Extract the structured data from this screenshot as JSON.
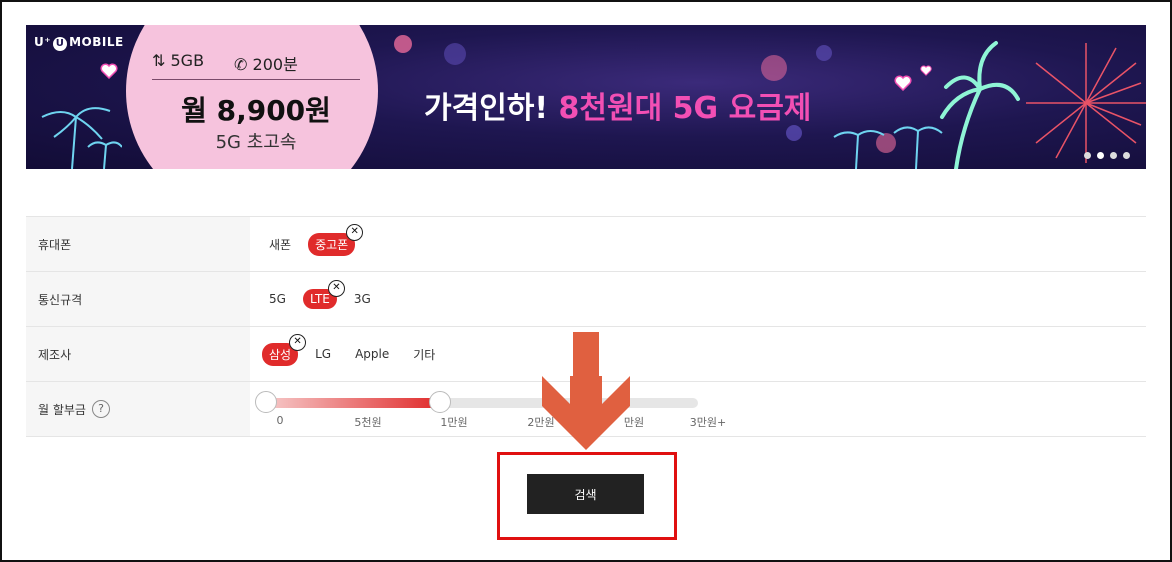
{
  "banner": {
    "logo_prefix": "U⁺",
    "logo_u": "U",
    "logo_text": "MOBILE",
    "data_amount": "⇅ 5GB",
    "call_amount": "✆ 200분",
    "price": "월 8,900원",
    "speed": "5G 초고속",
    "headline_white": "가격인하! ",
    "headline_pink": "8천원대 5G 요금제"
  },
  "filters": {
    "phone": {
      "label": "휴대폰",
      "options": [
        "새폰",
        "중고폰"
      ],
      "selected": "중고폰"
    },
    "network": {
      "label": "통신규격",
      "options": [
        "5G",
        "LTE",
        "3G"
      ],
      "selected": "LTE"
    },
    "maker": {
      "label": "제조사",
      "options": [
        "삼성",
        "LG",
        "Apple",
        "기타"
      ],
      "selected": "삼성"
    },
    "discount": {
      "label": "월 할부금",
      "help": "?",
      "ticks": [
        "0",
        "5천원",
        "1만원",
        "2만원",
        "만원",
        "3만원+"
      ],
      "range_start": 0,
      "range_end": 10000
    }
  },
  "clear_icon": "✕",
  "search_button": "검색",
  "colors": {
    "accent": "#e02b2b",
    "banner_bg": "#1e1650",
    "pink": "#f24fb4",
    "highlight": "#e01010",
    "arrow": "#e06040"
  }
}
